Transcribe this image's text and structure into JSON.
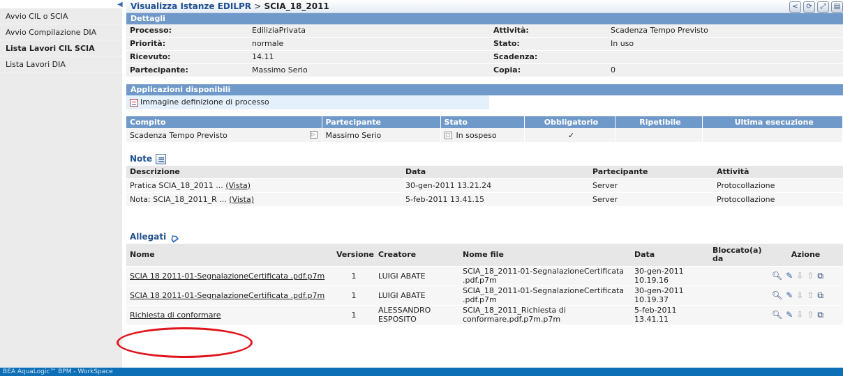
{
  "sidebar": {
    "items": [
      {
        "label": "Avvio CIL o SCIA"
      },
      {
        "label": "Avvio Compilazione DIA"
      },
      {
        "label": "Lista Lavori CIL SCIA"
      },
      {
        "label": "Lista Lavori DIA"
      }
    ]
  },
  "header": {
    "title_prefix": "Visualizza Istanze EDILPR",
    "separator": ">",
    "title_current": "SCIA_18_2011"
  },
  "details": {
    "title": "Dettagli",
    "rows": [
      {
        "k1": "Processo:",
        "v1": "EdiliziaPrivata",
        "k2": "Attività:",
        "v2": "Scadenza Tempo Previsto"
      },
      {
        "k1": "Priorità:",
        "v1": "normale",
        "k2": "Stato:",
        "v2": "In uso"
      },
      {
        "k1": "Ricevuto:",
        "v1": "14.11",
        "k2": "Scadenza:",
        "v2": ""
      },
      {
        "k1": "Partecipante:",
        "v1": "Massimo Serio",
        "k2": "Copia:",
        "v2": "0"
      }
    ]
  },
  "apps": {
    "title": "Applicazioni disponibili",
    "item": "Immagine definizione di processo"
  },
  "tasks": {
    "headers": [
      "Compito",
      "Partecipante",
      "Stato",
      "Obbligatorio",
      "Ripetibile",
      "Ultima esecuzione"
    ],
    "row": {
      "compito": "Scadenza Tempo Previsto",
      "partecipante": "Massimo Serio",
      "stato": "In sospeso",
      "obbligatorio": "✓",
      "ripetibile": "",
      "ultima": ""
    }
  },
  "notes": {
    "title": "Note",
    "headers": [
      "Descrizione",
      "Data",
      "Partecipante",
      "Attività"
    ],
    "rows": [
      {
        "desc": "Pratica SCIA_18_2011 ...",
        "link": "(Vista)",
        "data": "30-gen-2011 13.21.24",
        "partecipante": "Server",
        "attivita": "Protocollazione"
      },
      {
        "desc": "Nota: SCIA_18_2011_R ...",
        "link": "(Vista)",
        "data": "5-feb-2011 13.41.15",
        "partecipante": "Server",
        "attivita": "Protocollazione"
      }
    ]
  },
  "attachments": {
    "title": "Allegati",
    "headers": [
      "Nome",
      "Versione",
      "Creatore",
      "Nome file",
      "Data",
      "Bloccato(a) da",
      "Azione"
    ],
    "rows": [
      {
        "nome": "SCIA 18 2011-01-SegnalazioneCertificata .pdf.p7m",
        "versione": "1",
        "creatore": "LUIGI ABATE",
        "file": "SCIA_18_2011-01-SegnalazioneCertificata .pdf.p7m",
        "data": "30-gen-2011 10.19.16",
        "bloccato": ""
      },
      {
        "nome": "SCIA 18 2011-01-SegnalazioneCertificata .pdf.p7m",
        "versione": "1",
        "creatore": "LUIGI ABATE",
        "file": "SCIA_18_2011-01-SegnalazioneCertificata .pdf.p7m",
        "data": "30-gen-2011 10.19.37",
        "bloccato": ""
      },
      {
        "nome": "Richiesta di conformare",
        "versione": "1",
        "creatore": "ALESSANDRO ESPOSITO",
        "file": "SCIA_18_2011_Richiesta di conformare.pdf.p7m.p7m",
        "data": "5-feb-2011 13.41.11",
        "bloccato": ""
      }
    ]
  },
  "footer": {
    "text": "BEA AquaLogic™ BPM - WorkSpace"
  },
  "colors": {
    "section_head": "#6f99c8",
    "title_text": "#1f4f8f",
    "footer": "#0d6fb5",
    "highlight_circle": "#e0141c"
  },
  "icons": [
    "collapse-arrow-icon",
    "back-icon",
    "refresh-icon",
    "expand-icon",
    "print-icon",
    "process-image-icon",
    "activity-icon",
    "suspended-icon",
    "check-icon",
    "new-note-icon",
    "new-attachment-icon",
    "view-icon",
    "edit-icon",
    "download-icon",
    "upload-icon",
    "open-icon"
  ]
}
